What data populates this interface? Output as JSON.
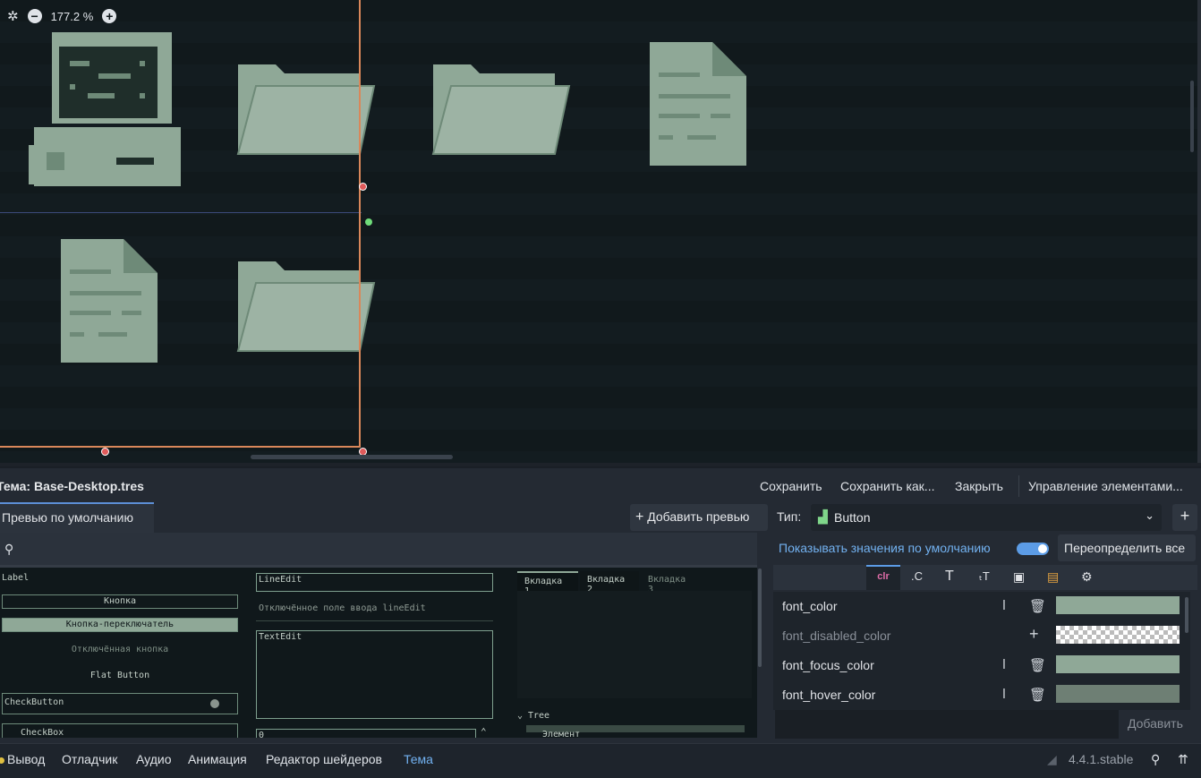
{
  "viewport": {
    "zoom": "177.2 %",
    "icons": [
      {
        "name": "computer-icon"
      },
      {
        "name": "folder-icon"
      },
      {
        "name": "folder-icon"
      },
      {
        "name": "document-icon"
      },
      {
        "name": "document-icon"
      },
      {
        "name": "folder-icon"
      }
    ]
  },
  "theme": {
    "title": "Тема: Base-Desktop.tres",
    "actions": [
      "Сохранить",
      "Сохранить как...",
      "Закрыть",
      "Управление элементами..."
    ],
    "preview_tab": "Превью по умолчанию",
    "add_preview": "Добавить превью",
    "preview": {
      "label": "Label",
      "button": "Кнопка",
      "toggle_button": "Кнопка-переключатель",
      "disabled_button": "Отключённая кнопка",
      "flat_button": "Flat Button",
      "check_button": "CheckButton",
      "checkbox": "CheckBox",
      "line_edit": "LineEdit",
      "disabled_line_edit": "Отключённое поле ввода lineEdit",
      "text_edit": "TextEdit",
      "spin_value": "0",
      "tabs": [
        "Вкладка 1",
        "Вкладка 2",
        "Вкладка 3"
      ],
      "tree": "Tree",
      "tree_item": "Элемент"
    },
    "type_label": "Тип:",
    "type_value": "Button",
    "show_defaults": "Показывать значения по умолчанию",
    "show_defaults_on": true,
    "override_all": "Переопределить все",
    "properties": [
      {
        "name": "font_color",
        "color": "#8fa897",
        "overridden": true
      },
      {
        "name": "font_disabled_color",
        "color": "transparent",
        "overridden": false
      },
      {
        "name": "font_focus_color",
        "color": "#8fa897",
        "overridden": true
      },
      {
        "name": "font_hover_color",
        "color": "#6e7f74",
        "overridden": true
      }
    ],
    "add_label": "Добавить"
  },
  "bottom": {
    "tabs": [
      "Вывод",
      "Отладчик",
      "Аудио",
      "Анимация",
      "Редактор шейдеров",
      "Тема"
    ],
    "active_tab": "Тема",
    "version": "4.4.1.stable"
  },
  "colors": {
    "accent": "#5c9ce6",
    "icon_fill": "#8fa897",
    "icon_dark": "#6e8a78",
    "bg_viewport": "#10181b",
    "guide": "#d9875a"
  }
}
